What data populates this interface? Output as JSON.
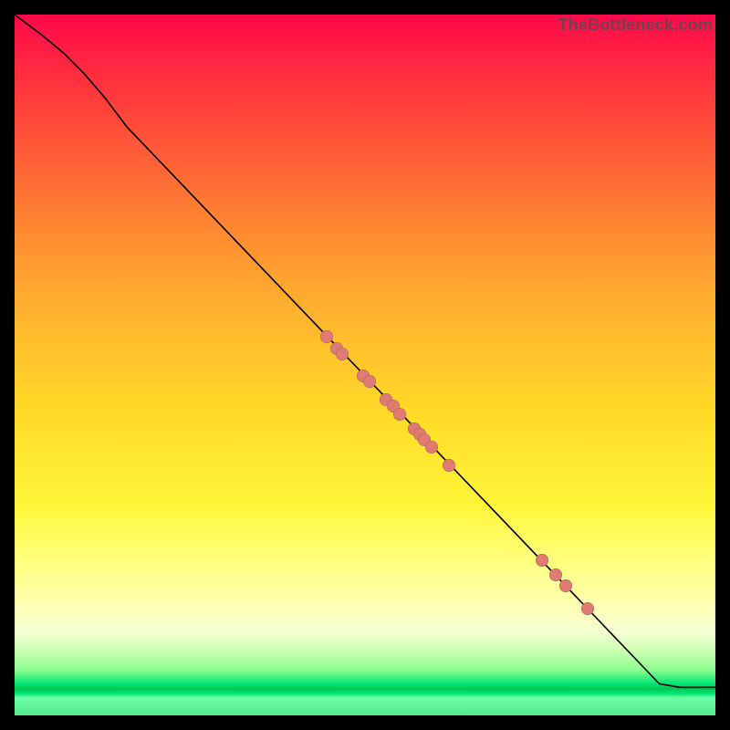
{
  "watermark": "TheBottleneck.com",
  "colors": {
    "dot": "#e07b74",
    "line": "#000000"
  },
  "chart_data": {
    "type": "line",
    "title": "",
    "xlabel": "",
    "ylabel": "",
    "xlim": [
      0,
      100
    ],
    "ylim": [
      0,
      100
    ],
    "grid": false,
    "legend": false,
    "curve": [
      {
        "x": 0,
        "y": 100
      },
      {
        "x": 4,
        "y": 97
      },
      {
        "x": 7,
        "y": 94.5
      },
      {
        "x": 10,
        "y": 91.5
      },
      {
        "x": 13,
        "y": 88
      },
      {
        "x": 16,
        "y": 84
      },
      {
        "x": 92,
        "y": 4.5
      },
      {
        "x": 95,
        "y": 4
      },
      {
        "x": 100,
        "y": 4
      }
    ],
    "points": [
      {
        "x": 44.5,
        "y": 54.0
      },
      {
        "x": 46.0,
        "y": 52.4
      },
      {
        "x": 46.8,
        "y": 51.6
      },
      {
        "x": 49.8,
        "y": 48.5
      },
      {
        "x": 50.6,
        "y": 47.6
      },
      {
        "x": 53.0,
        "y": 45.1
      },
      {
        "x": 54.0,
        "y": 44.1
      },
      {
        "x": 55.0,
        "y": 43.0
      },
      {
        "x": 57.0,
        "y": 40.9
      },
      {
        "x": 57.8,
        "y": 40.1
      },
      {
        "x": 58.5,
        "y": 39.3
      },
      {
        "x": 59.5,
        "y": 38.3
      },
      {
        "x": 62.0,
        "y": 35.7
      },
      {
        "x": 75.2,
        "y": 22.2
      },
      {
        "x": 77.2,
        "y": 20.1
      },
      {
        "x": 78.7,
        "y": 18.5
      },
      {
        "x": 81.8,
        "y": 15.2
      }
    ]
  }
}
